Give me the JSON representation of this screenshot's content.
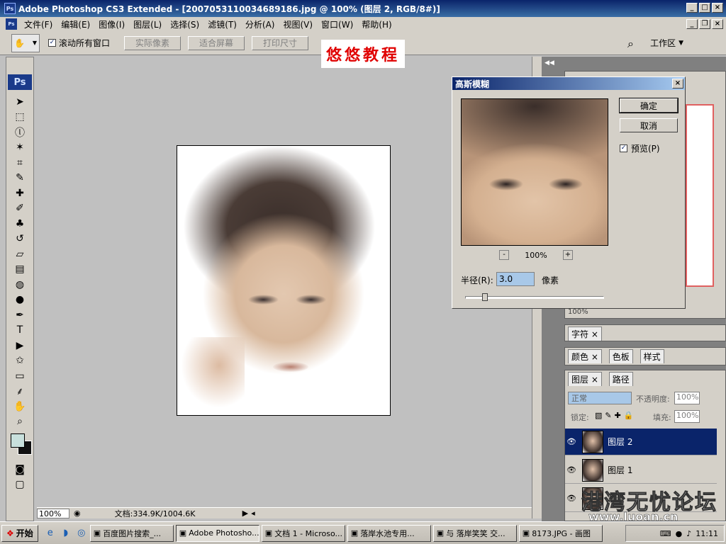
{
  "window": {
    "title": "Adobe Photoshop CS3 Extended - [20070531100346891­86.jpg @ 100% (图层 2, RGB/8#)]",
    "ps_badge": "Ps"
  },
  "menu": {
    "items": [
      "文件(F)",
      "编辑(E)",
      "图像(I)",
      "图层(L)",
      "选择(S)",
      "滤镜(T)",
      "分析(A)",
      "视图(V)",
      "窗口(W)",
      "帮助(H)"
    ]
  },
  "options": {
    "scroll_all": "滚动所有窗口",
    "actual_pixels": "实际像素",
    "fit_screen": "适合屏幕",
    "print_size": "打印尺寸",
    "workspace": "工作区"
  },
  "banner": "悠悠教程",
  "toolbox": {
    "logo": "Ps",
    "tools": [
      {
        "name": "move-tool",
        "glyph": "➤"
      },
      {
        "name": "marquee-tool",
        "glyph": "⬚"
      },
      {
        "name": "lasso-tool",
        "glyph": "ⓛ"
      },
      {
        "name": "magic-wand-tool",
        "glyph": "✶"
      },
      {
        "name": "crop-tool",
        "glyph": "⌗"
      },
      {
        "name": "slice-tool",
        "glyph": "✎"
      },
      {
        "name": "healing-tool",
        "glyph": "✚"
      },
      {
        "name": "brush-tool",
        "glyph": "✐"
      },
      {
        "name": "stamp-tool",
        "glyph": "♣"
      },
      {
        "name": "history-brush-tool",
        "glyph": "↺"
      },
      {
        "name": "eraser-tool",
        "glyph": "▱"
      },
      {
        "name": "gradient-tool",
        "glyph": "▤"
      },
      {
        "name": "blur-tool",
        "glyph": "◍"
      },
      {
        "name": "dodge-tool",
        "glyph": "●"
      },
      {
        "name": "pen-tool",
        "glyph": "✒"
      },
      {
        "name": "type-tool",
        "glyph": "T"
      },
      {
        "name": "path-select-tool",
        "glyph": "▶"
      },
      {
        "name": "shape-tool",
        "glyph": "✩"
      },
      {
        "name": "notes-tool",
        "glyph": "▭"
      },
      {
        "name": "eyedropper-tool",
        "glyph": "⸙"
      },
      {
        "name": "hand-tool",
        "glyph": "✋"
      },
      {
        "name": "zoom-tool",
        "glyph": "⌕"
      }
    ]
  },
  "status": {
    "zoom": "100%",
    "doc": "文档:334.9K/1004.6K"
  },
  "dialog": {
    "title": "高斯模糊",
    "ok": "确定",
    "cancel": "取消",
    "preview_label": "预览(P)",
    "zoom": "100%",
    "radius_label": "半径(R):",
    "radius_value": "3.0",
    "radius_unit": "像素",
    "radius_fraction": 0.12
  },
  "panels": {
    "nav_zoom": "100%",
    "char_tab": "字符",
    "color_tab": "颜色",
    "swatch_tab": "色板",
    "style_tab": "样式",
    "layers_tab": "图层",
    "paths_tab": "路径",
    "blend_mode": "正常",
    "opacity_label": "不透明度:",
    "opacity_value": "100%",
    "lock_label": "锁定:",
    "fill_label": "填充:",
    "fill_value": "100%",
    "layers": [
      {
        "name": "图层 2",
        "selected": true
      },
      {
        "name": "图层 1",
        "selected": false
      },
      {
        "name": "背景",
        "selected": false
      }
    ]
  },
  "watermark": {
    "text": "港湾无忧论坛",
    "url": "www.luoan.cn"
  },
  "taskbar": {
    "start": "开始",
    "items": [
      {
        "label": "百度图片搜索_...",
        "active": false
      },
      {
        "label": "Adobe Photosho...",
        "active": true
      },
      {
        "label": "文档 1 - Microso...",
        "active": false
      },
      {
        "label": "落岸水池专用...",
        "active": false
      },
      {
        "label": "与 落岸笑笑 交...",
        "active": false
      },
      {
        "label": "8173.JPG - 画图",
        "active": false
      }
    ],
    "clock": "11:11"
  }
}
